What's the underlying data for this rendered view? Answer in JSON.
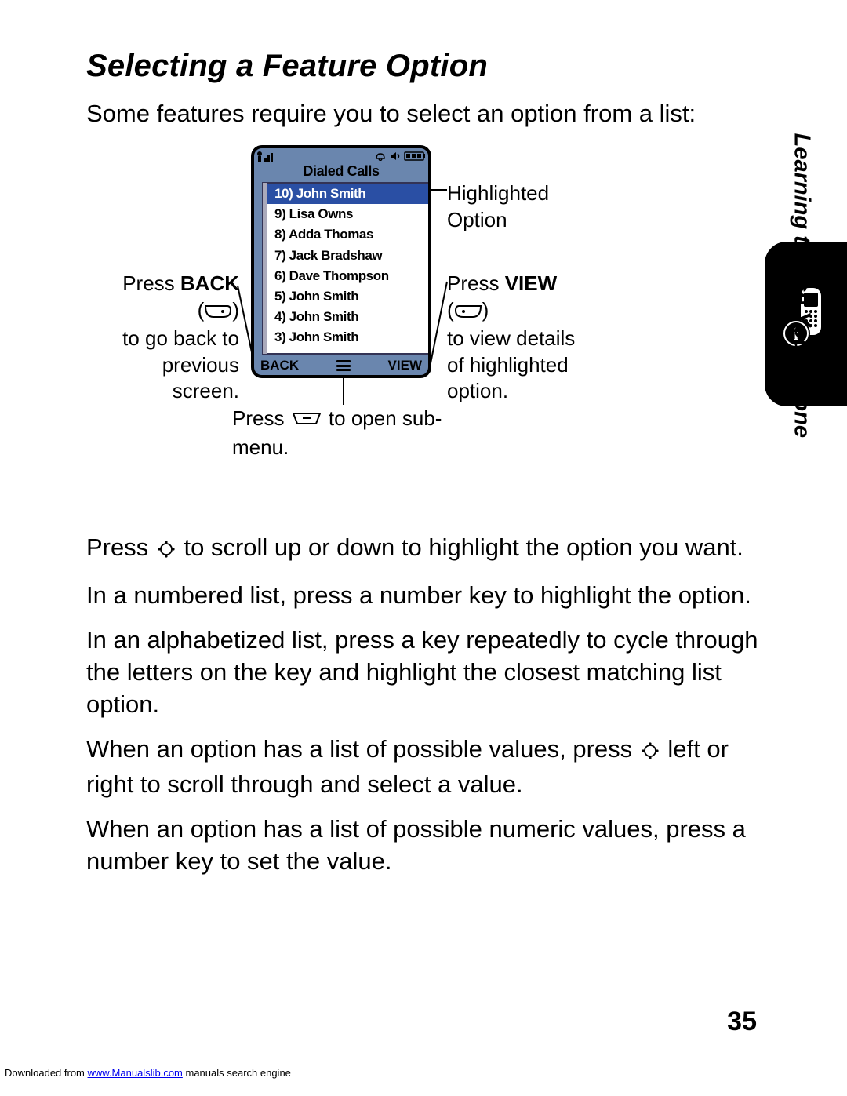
{
  "title": "Selecting a Feature Option",
  "intro": "Some features require you to select an option from a list:",
  "phone": {
    "header": "Dialed Calls",
    "soft_left": "BACK",
    "soft_right": "VIEW",
    "list": [
      {
        "n": "10",
        "name": "John Smith",
        "hi": true
      },
      {
        "n": "9",
        "name": "Lisa Owns"
      },
      {
        "n": "8",
        "name": "Adda Thomas"
      },
      {
        "n": "7",
        "name": "Jack Bradshaw"
      },
      {
        "n": "6",
        "name": "Dave Thompson"
      },
      {
        "n": "5",
        "name": "John Smith"
      },
      {
        "n": "4",
        "name": "John Smith"
      },
      {
        "n": "3",
        "name": "John Smith"
      }
    ]
  },
  "callouts": {
    "highlighted_l1": "Highlighted",
    "highlighted_l2": "Option",
    "view_head_pre": "Press ",
    "view_head_bold": "VIEW",
    "view_l2": "to view details",
    "view_l3": "of highlighted",
    "view_l4": "option.",
    "back_head_pre": "Press ",
    "back_head_bold": "BACK",
    "back_l2": "to go back to",
    "back_l3": "previous",
    "back_l4": "screen.",
    "submenu_pre": "Press ",
    "submenu_post": " to open sub-",
    "submenu_l2": "menu."
  },
  "paras": {
    "p1_pre": "Press ",
    "p1_post": " to scroll up or down to highlight the option you want.",
    "p2": "In a numbered list, press a number key to highlight the option.",
    "p3": "In an alphabetized list, press a key repeatedly to cycle through the letters on the key and highlight the closest matching list option.",
    "p4_pre": "When an option has a list of possible values, press ",
    "p4_post": " left or right to scroll through and select a value.",
    "p5": "When an option has a list of possible numeric values, press a number key to set the value."
  },
  "chapter": "Learning to Use Your Phone",
  "page_number": "35",
  "footer": {
    "pre": "Downloaded from ",
    "link": "www.Manualslib.com",
    "post": " manuals search engine"
  }
}
